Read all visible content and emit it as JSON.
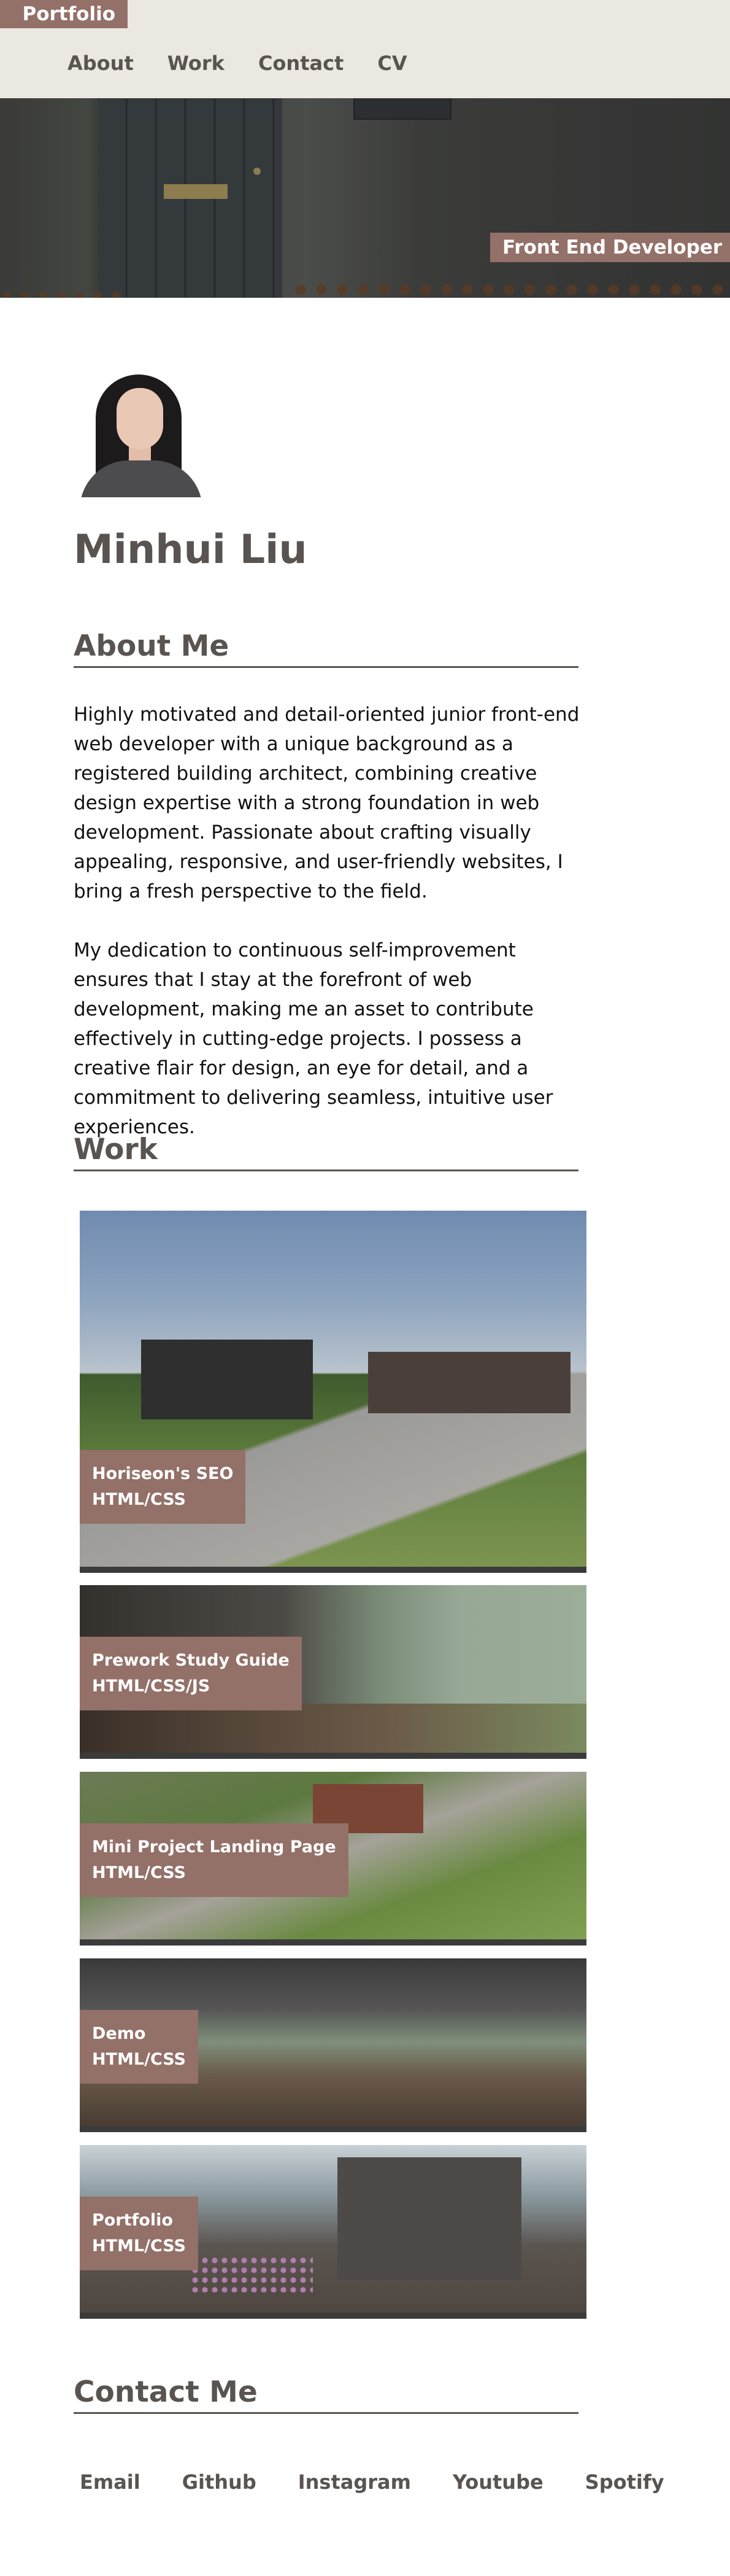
{
  "brand": {
    "label": "Portfolio"
  },
  "nav": {
    "items": [
      "About",
      "Work",
      "Contact",
      "CV"
    ]
  },
  "hero": {
    "tagline": "Front End Developer"
  },
  "profile": {
    "name": "Minhui Liu"
  },
  "about": {
    "title": "About Me",
    "paragraphs": [
      "Highly motivated and detail-oriented junior front-end web developer with a unique background as a registered building architect, combining creative design expertise with a strong foundation in web development. Passionate about crafting visually appealing, responsive, and user-friendly websites, I bring a fresh perspective to the field.",
      "My dedication to continuous self-improvement ensures that I stay at the forefront of web development, making me an asset to contribute effectively in cutting-edge projects. I possess a creative flair for design, an eye for detail, and a commitment to delivering seamless, intuitive user experiences."
    ]
  },
  "work": {
    "title": "Work",
    "projects": [
      {
        "title": "Horiseon's SEO",
        "tech": "HTML/CSS"
      },
      {
        "title": "Prework Study Guide",
        "tech": "HTML/CSS/JS"
      },
      {
        "title": "Mini Project Landing Page",
        "tech": "HTML/CSS"
      },
      {
        "title": "Demo",
        "tech": "HTML/CSS"
      },
      {
        "title": "Portfolio",
        "tech": "HTML/CSS"
      }
    ]
  },
  "contact": {
    "title": "Contact Me",
    "links": [
      "Email",
      "Github",
      "Instagram",
      "Youtube",
      "Spotify"
    ]
  },
  "colors": {
    "accent": "#937068",
    "text": "#595450",
    "header_bg": "#ebe8e2"
  }
}
